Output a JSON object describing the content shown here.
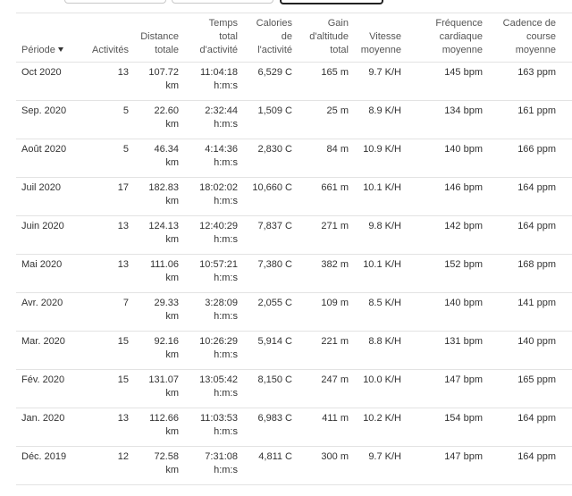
{
  "headers": {
    "period": "Période",
    "activities": "Activités",
    "distance": [
      "Distance",
      "totale"
    ],
    "time": [
      "Temps",
      "total",
      "d'activité"
    ],
    "calories": [
      "Calories",
      "de",
      "l'activité"
    ],
    "elevation": [
      "Gain",
      "d'altitude",
      "total"
    ],
    "speed": [
      "Vitesse",
      "moyenne"
    ],
    "heart": [
      "Fréquence",
      "cardiaque",
      "moyenne"
    ],
    "cadence": [
      "Cadence de",
      "course",
      "moyenne"
    ]
  },
  "rows": [
    {
      "period": "Oct 2020",
      "activities": "13",
      "distance": "107.72",
      "distance_unit": "km",
      "time": "11:04:18",
      "time_unit": "h:m:s",
      "calories": "6,529 C",
      "elevation": "165 m",
      "speed": "9.7 K/H",
      "heart": "145 bpm",
      "cadence": "163 ppm"
    },
    {
      "period": "Sep. 2020",
      "activities": "5",
      "distance": "22.60",
      "distance_unit": "km",
      "time": "2:32:44",
      "time_unit": "h:m:s",
      "calories": "1,509 C",
      "elevation": "25 m",
      "speed": "8.9 K/H",
      "heart": "134 bpm",
      "cadence": "161 ppm"
    },
    {
      "period": "Août 2020",
      "activities": "5",
      "distance": "46.34",
      "distance_unit": "km",
      "time": "4:14:36",
      "time_unit": "h:m:s",
      "calories": "2,830 C",
      "elevation": "84 m",
      "speed": "10.9 K/H",
      "heart": "140 bpm",
      "cadence": "166 ppm"
    },
    {
      "period": "Juil 2020",
      "activities": "17",
      "distance": "182.83",
      "distance_unit": "km",
      "time": "18:02:02",
      "time_unit": "h:m:s",
      "calories": "10,660 C",
      "elevation": "661 m",
      "speed": "10.1 K/H",
      "heart": "146 bpm",
      "cadence": "164 ppm"
    },
    {
      "period": "Juin 2020",
      "activities": "13",
      "distance": "124.13",
      "distance_unit": "km",
      "time": "12:40:29",
      "time_unit": "h:m:s",
      "calories": "7,837 C",
      "elevation": "271 m",
      "speed": "9.8 K/H",
      "heart": "142 bpm",
      "cadence": "164 ppm"
    },
    {
      "period": "Mai 2020",
      "activities": "13",
      "distance": "111.06",
      "distance_unit": "km",
      "time": "10:57:21",
      "time_unit": "h:m:s",
      "calories": "7,380 C",
      "elevation": "382 m",
      "speed": "10.1 K/H",
      "heart": "152 bpm",
      "cadence": "168 ppm"
    },
    {
      "period": "Avr. 2020",
      "activities": "7",
      "distance": "29.33",
      "distance_unit": "km",
      "time": "3:28:09",
      "time_unit": "h:m:s",
      "calories": "2,055 C",
      "elevation": "109 m",
      "speed": "8.5 K/H",
      "heart": "140 bpm",
      "cadence": "141 ppm"
    },
    {
      "period": "Mar. 2020",
      "activities": "15",
      "distance": "92.16",
      "distance_unit": "km",
      "time": "10:26:29",
      "time_unit": "h:m:s",
      "calories": "5,914 C",
      "elevation": "221 m",
      "speed": "8.8 K/H",
      "heart": "131 bpm",
      "cadence": "140 ppm"
    },
    {
      "period": "Fév. 2020",
      "activities": "15",
      "distance": "131.07",
      "distance_unit": "km",
      "time": "13:05:42",
      "time_unit": "h:m:s",
      "calories": "8,150 C",
      "elevation": "247 m",
      "speed": "10.0 K/H",
      "heart": "147 bpm",
      "cadence": "165 ppm"
    },
    {
      "period": "Jan. 2020",
      "activities": "13",
      "distance": "112.66",
      "distance_unit": "km",
      "time": "11:03:53",
      "time_unit": "h:m:s",
      "calories": "6,983 C",
      "elevation": "411 m",
      "speed": "10.2 K/H",
      "heart": "154 bpm",
      "cadence": "164 ppm"
    },
    {
      "period": "Déc. 2019",
      "activities": "12",
      "distance": "72.58",
      "distance_unit": "km",
      "time": "7:31:08",
      "time_unit": "h:m:s",
      "calories": "4,811 C",
      "elevation": "300 m",
      "speed": "9.7 K/H",
      "heart": "147 bpm",
      "cadence": "164 ppm"
    }
  ]
}
